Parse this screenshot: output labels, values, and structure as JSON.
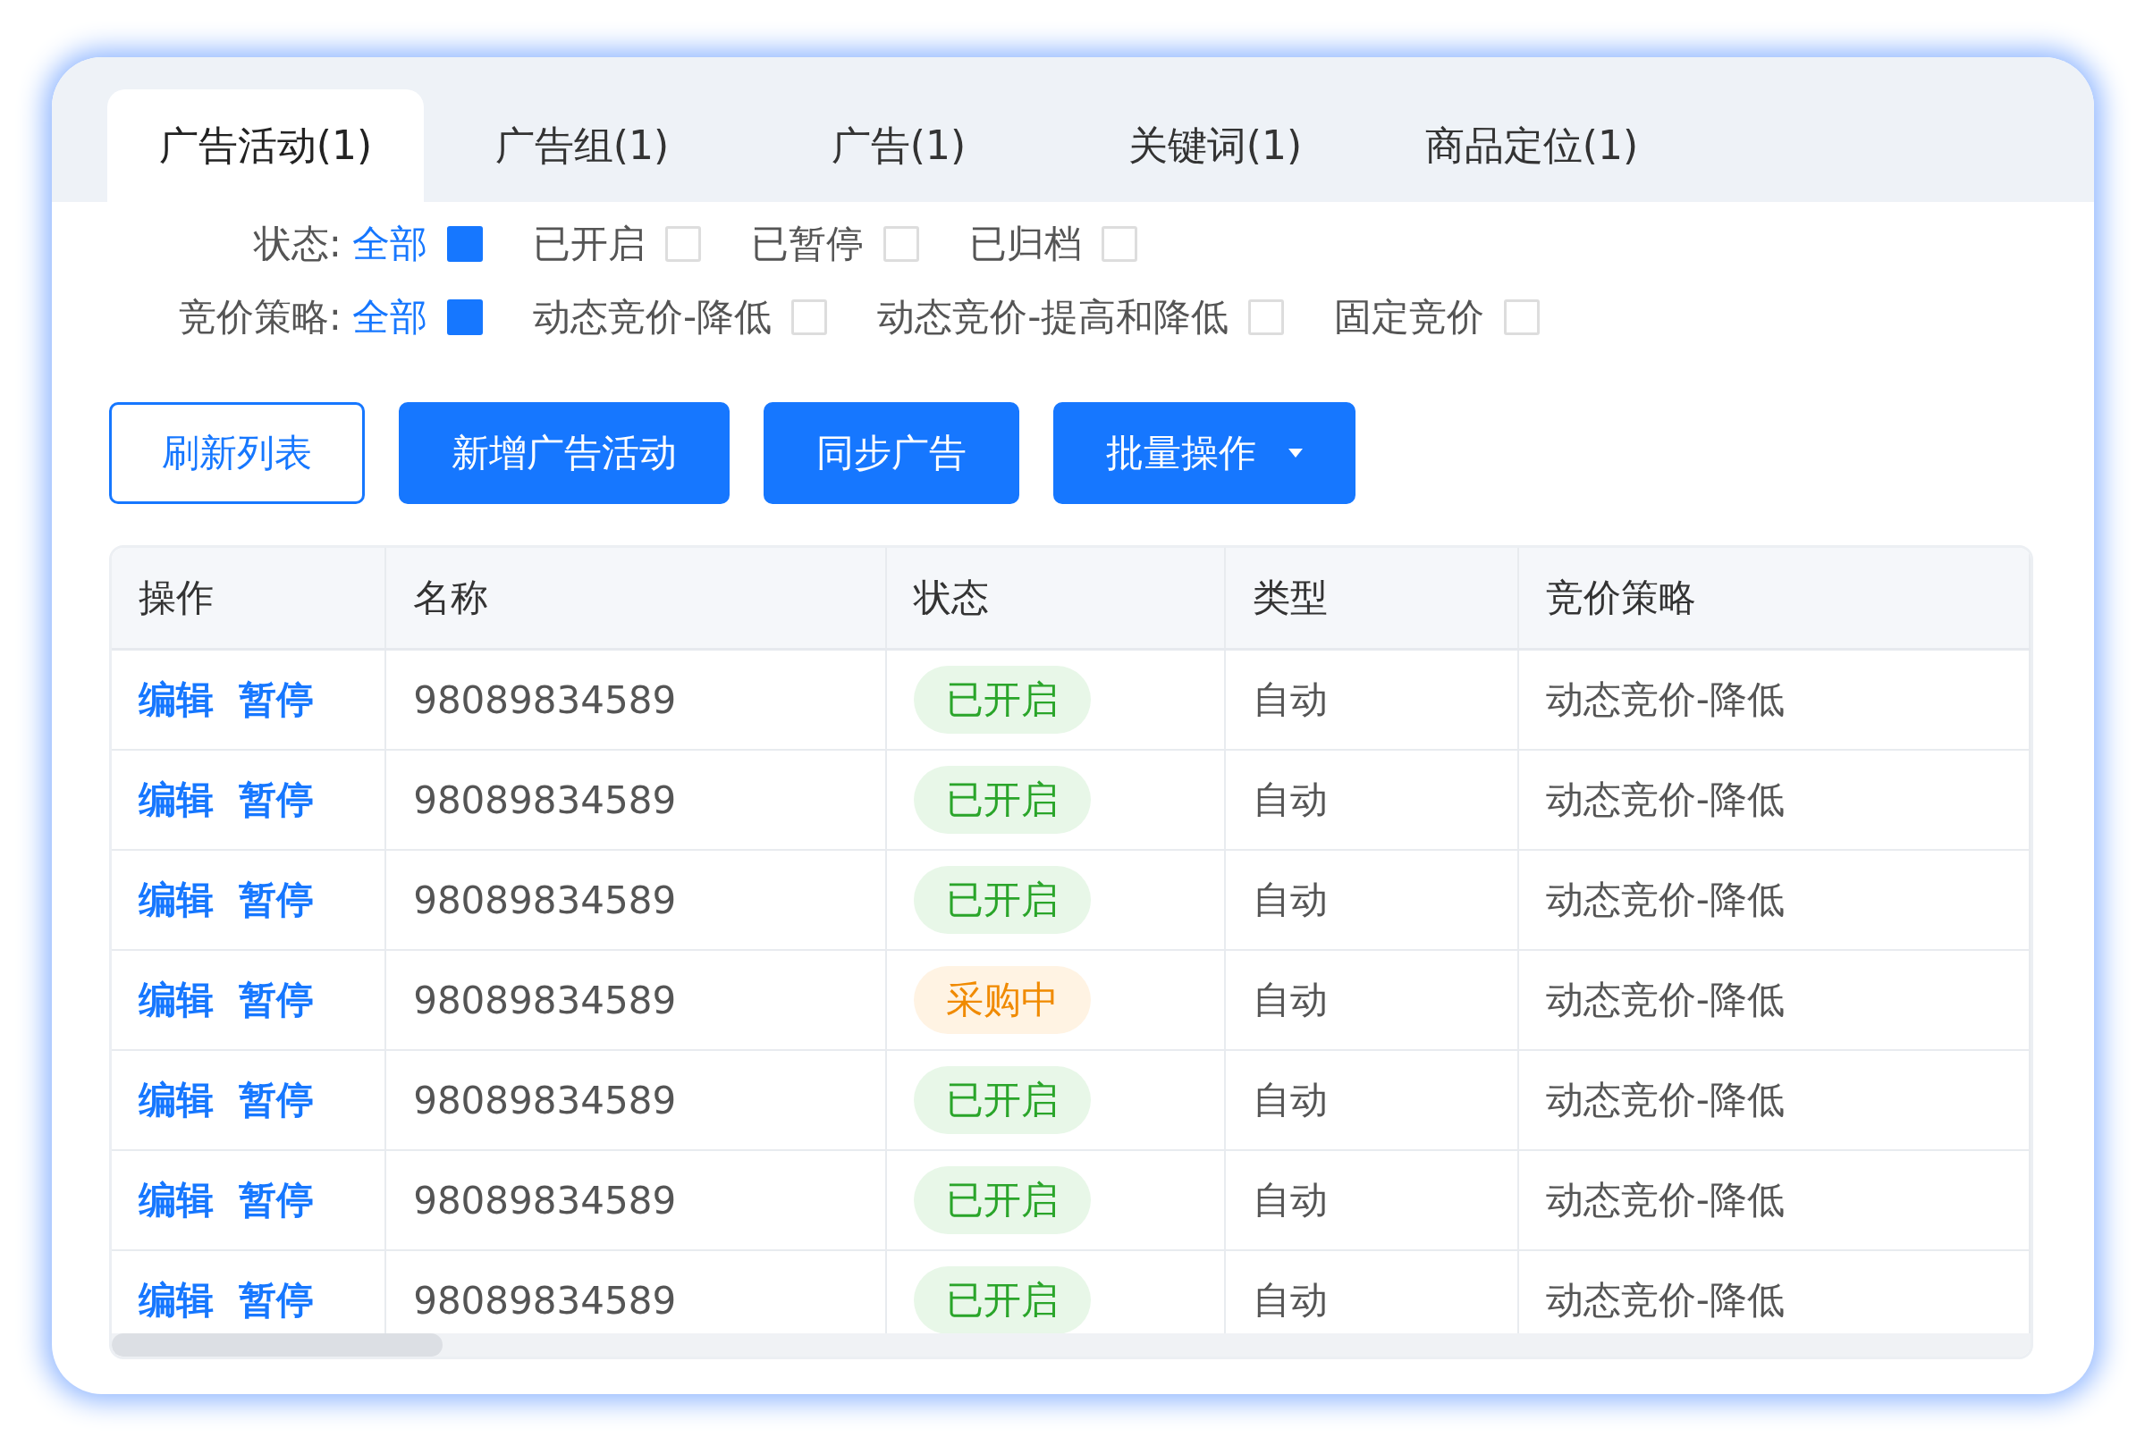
{
  "tabs": [
    {
      "label": "广告活动(1)",
      "selected": true
    },
    {
      "label": "广告组(1)",
      "selected": false
    },
    {
      "label": "广告(1)",
      "selected": false
    },
    {
      "label": "关键词(1)",
      "selected": false
    },
    {
      "label": "商品定位(1)",
      "selected": false
    }
  ],
  "filters": [
    {
      "label": "状态:",
      "options": [
        {
          "label": "全部",
          "selected": true
        },
        {
          "label": "已开启",
          "selected": false
        },
        {
          "label": "已暂停",
          "selected": false
        },
        {
          "label": "已归档",
          "selected": false
        }
      ]
    },
    {
      "label": "竞价策略:",
      "options": [
        {
          "label": "全部",
          "selected": true
        },
        {
          "label": "动态竞价-降低",
          "selected": false
        },
        {
          "label": "动态竞价-提高和降低",
          "selected": false
        },
        {
          "label": "固定竞价",
          "selected": false
        }
      ]
    }
  ],
  "buttons": [
    {
      "label": "刷新列表",
      "kind": "outline"
    },
    {
      "label": "新增广告活动",
      "kind": "primary"
    },
    {
      "label": "同步广告",
      "kind": "primary"
    },
    {
      "label": "批量操作",
      "kind": "dropdown"
    }
  ],
  "table": {
    "columns": [
      "操作",
      "名称",
      "状态",
      "类型",
      "竞价策略"
    ],
    "rows": [
      {
        "actions": [
          "编辑",
          "暂停"
        ],
        "name": "98089834589",
        "status": {
          "label": "已开启",
          "kind": "success"
        },
        "type": "自动",
        "strategy": "动态竞价-降低"
      },
      {
        "actions": [
          "编辑",
          "暂停"
        ],
        "name": "98089834589",
        "status": {
          "label": "已开启",
          "kind": "success"
        },
        "type": "自动",
        "strategy": "动态竞价-降低"
      },
      {
        "actions": [
          "编辑",
          "暂停"
        ],
        "name": "98089834589",
        "status": {
          "label": "已开启",
          "kind": "success"
        },
        "type": "自动",
        "strategy": "动态竞价-降低"
      },
      {
        "actions": [
          "编辑",
          "暂停"
        ],
        "name": "98089834589",
        "status": {
          "label": "采购中",
          "kind": "warning"
        },
        "type": "自动",
        "strategy": "动态竞价-降低"
      },
      {
        "actions": [
          "编辑",
          "暂停"
        ],
        "name": "98089834589",
        "status": {
          "label": "已开启",
          "kind": "success"
        },
        "type": "自动",
        "strategy": "动态竞价-降低"
      },
      {
        "actions": [
          "编辑",
          "暂停"
        ],
        "name": "98089834589",
        "status": {
          "label": "已开启",
          "kind": "success"
        },
        "type": "自动",
        "strategy": "动态竞价-降低"
      },
      {
        "actions": [
          "编辑",
          "暂停"
        ],
        "name": "98089834589",
        "status": {
          "label": "已开启",
          "kind": "success"
        },
        "type": "自动",
        "strategy": "动态竞价-降低"
      }
    ]
  }
}
